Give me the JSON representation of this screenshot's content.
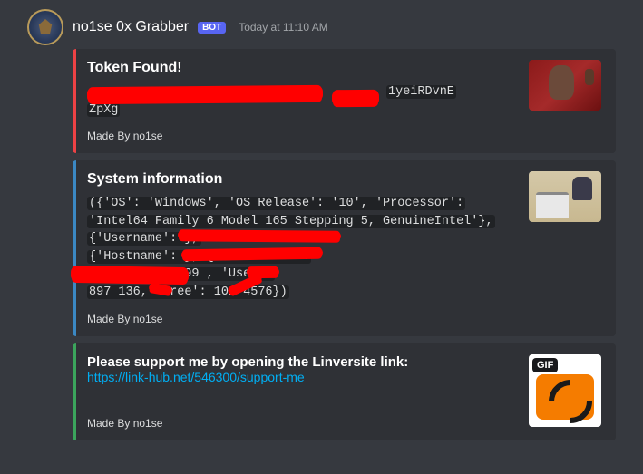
{
  "header": {
    "username": "no1se 0x Grabber",
    "bot_label": "BOT",
    "timestamp": "Today at 11:10 AM"
  },
  "embeds": {
    "token": {
      "title": "Token Found!",
      "line1_suffix": "1yeiRDvnE",
      "line2": "ZpXg",
      "footer": "Made By no1se"
    },
    "sysinfo": {
      "title": "System information",
      "line1": "({'OS': 'Windows', 'OS Release': '10', 'Processor':",
      "line2": "'Intel64 Family 6 Model 165 Stepping 5, GenuineIntel'},",
      "line3": "{'Username':                                     },",
      "line4": "{'Hostname':                          }, {'IP Address':",
      "line5": "          }, {'Total': 99         ,   'Used':",
      "line6": "897     136, 'Free': 101    4576})",
      "footer": "Made By no1se"
    },
    "support": {
      "text": "Please support me by opening the Linversite link:",
      "link": "https://link-hub.net/546300/support-me",
      "gif_label": "GIF",
      "footer": "Made By no1se"
    }
  }
}
